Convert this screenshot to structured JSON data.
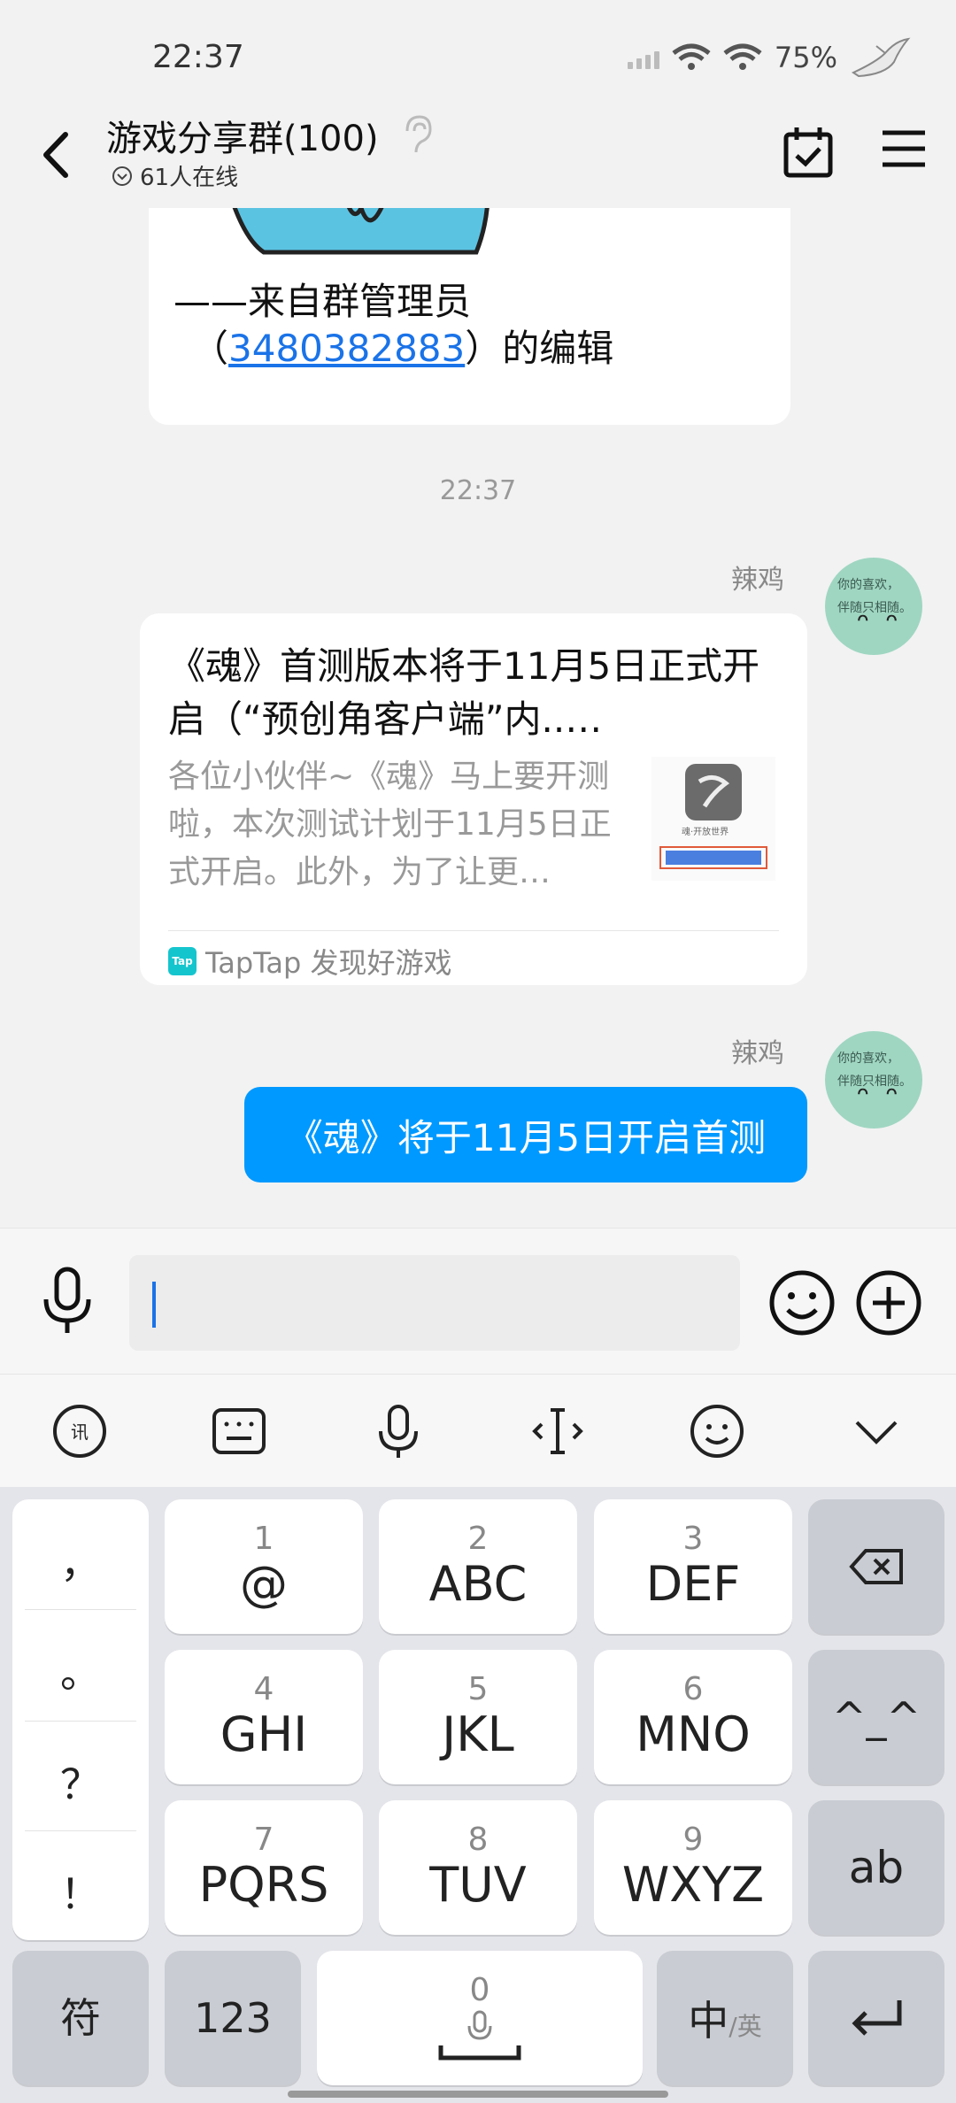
{
  "status_bar": {
    "time": "22:37",
    "battery": "75%",
    "icons": [
      "signal-icon",
      "wifi-icon",
      "wifi-icon",
      "bird-icon"
    ]
  },
  "header": {
    "title": "游戏分享群(100)",
    "online": "61人在线",
    "icons": [
      "back-icon",
      "ear-icon",
      "calendar-check-icon",
      "menu-icon"
    ]
  },
  "chat": {
    "top_card": {
      "line1": "——来自群管理员",
      "line2_prefix": "（",
      "qq_number": "3480382883",
      "line2_suffix": "）的编辑"
    },
    "timestamp": "22:37",
    "messages": [
      {
        "sender": "辣鸡",
        "avatar_text": "你的喜欢，\n伴随只相随。",
        "card": {
          "title": "《魂》首测版本将于11月5日正式开启（“预创角客户端”内..…",
          "description": "各位小伙伴~《魂》马上要开测啦，本次测试计划于11月5日正式开启。此外，为了让更…",
          "thumb_caption": "魂·开放世界",
          "source": "TapTap 发现好游戏",
          "source_logo": "Tap"
        }
      },
      {
        "sender": "辣鸡",
        "text": "《魂》将于11月5日开启首测"
      }
    ]
  },
  "input": {
    "value": "",
    "placeholder": ""
  },
  "keyboard": {
    "toolbar_icons": [
      "voice-input-icon",
      "keyboard-icon",
      "microphone-icon",
      "cursor-move-icon",
      "emoji-icon",
      "collapse-icon"
    ],
    "punctuation": [
      "，",
      "。",
      "？",
      "！"
    ],
    "rows": [
      [
        {
          "num": "1",
          "label": "@"
        },
        {
          "num": "2",
          "label": "ABC"
        },
        {
          "num": "3",
          "label": "DEF"
        }
      ],
      [
        {
          "num": "4",
          "label": "GHI"
        },
        {
          "num": "5",
          "label": "JKL"
        },
        {
          "num": "6",
          "label": "MNO"
        }
      ],
      [
        {
          "num": "7",
          "label": "PQRS"
        },
        {
          "num": "8",
          "label": "TUV"
        },
        {
          "num": "9",
          "label": "WXYZ"
        }
      ]
    ],
    "right_keys": [
      "backspace-icon",
      "^_^",
      "ab"
    ],
    "bottom": {
      "symbols": "符",
      "numbers": "123",
      "space_num": "0",
      "lang_main": "中",
      "lang_sub": "/英"
    },
    "enter_icon": "enter-icon"
  }
}
